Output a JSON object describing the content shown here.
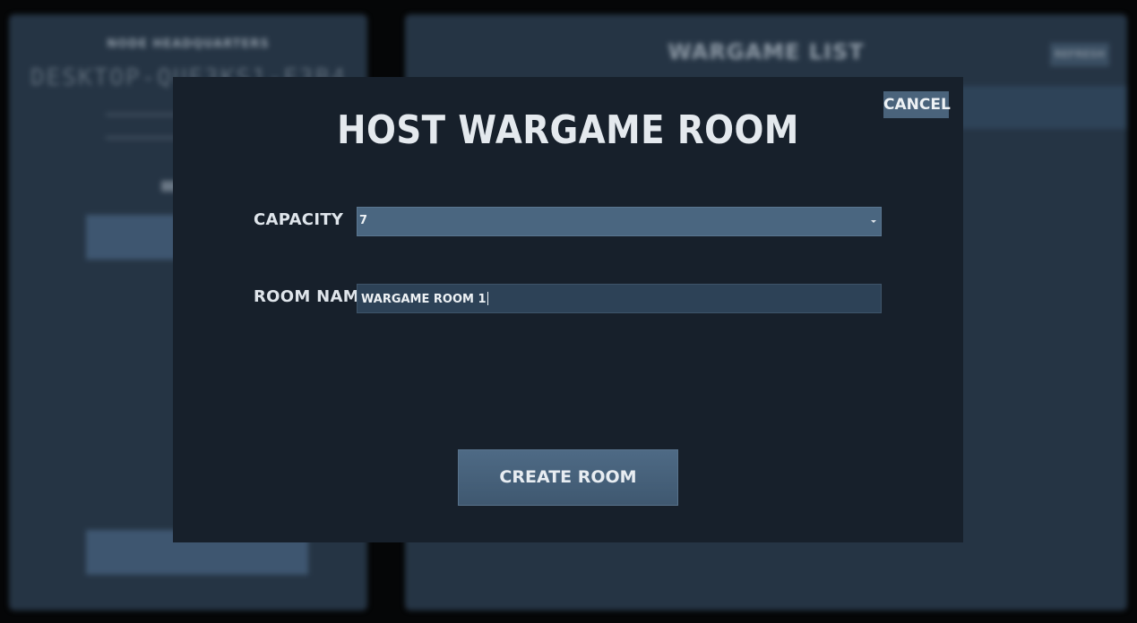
{
  "background": {
    "left_panel": {
      "title": "NODE HEADQUARTERS",
      "host_name": "DESKTOP-QUE3KS1-E3B4"
    },
    "right_panel": {
      "title": "WARGAME LIST",
      "refresh_label": "REFRESH"
    }
  },
  "modal": {
    "title": "HOST WARGAME ROOM",
    "cancel_label": "CANCEL",
    "capacity": {
      "label": "CAPACITY",
      "selected_value": "7"
    },
    "room_name": {
      "label": "ROOM NAME",
      "value": "WARGAME ROOM 1"
    },
    "create_label": "CREATE ROOM"
  },
  "icons": {
    "dropdown": "chevron-down-icon"
  },
  "colors": {
    "modal_bg": "#17202b",
    "select_bg": "#4a6680",
    "input_bg": "#2d4257",
    "button_bg": "#46607a",
    "text": "#e4e9ee"
  }
}
